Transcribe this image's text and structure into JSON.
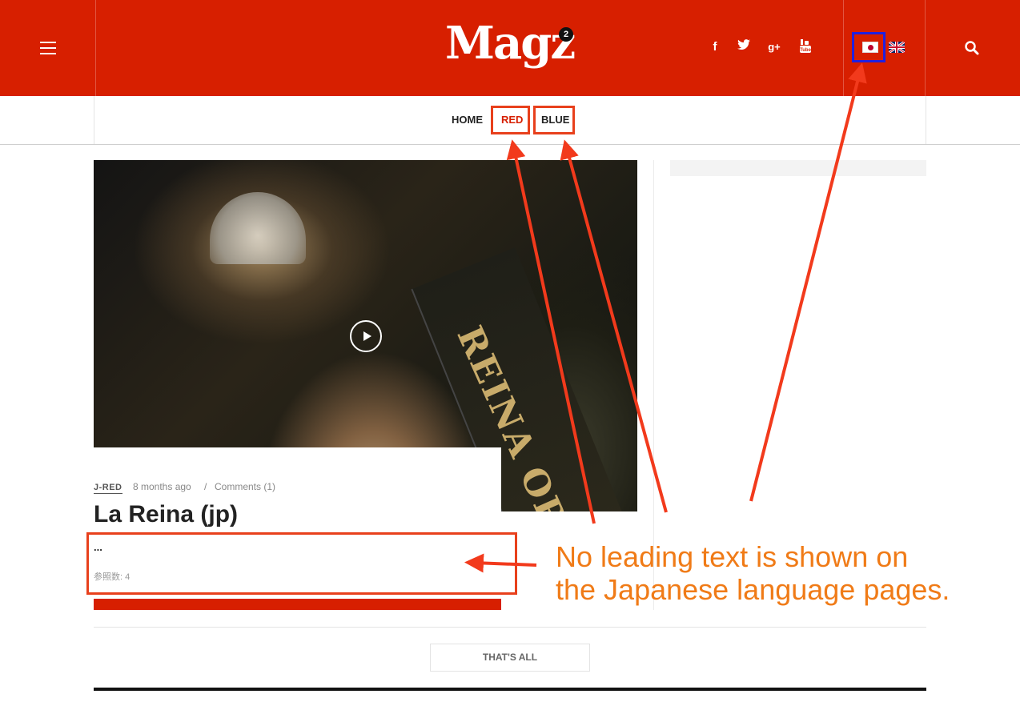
{
  "header": {
    "logo": "Magz",
    "logo_badge": "2",
    "social": [
      "f",
      "t",
      "g+",
      "You Tube"
    ],
    "flags": [
      "jp",
      "gb"
    ],
    "bg_color": "#d71f00"
  },
  "nav": {
    "items": [
      "HOME",
      "RED",
      "BLUE"
    ],
    "active": "RED"
  },
  "article": {
    "category": "J-RED",
    "time": "8 months ago",
    "separator": "/",
    "comments": "Comments (1)",
    "title": "La Reina (jp)",
    "excerpt": "...",
    "views": "参照数: 4"
  },
  "hero_image": {
    "sash_text": "REINA ORF"
  },
  "footer": {
    "more_label": "THAT'S ALL"
  },
  "annotation": {
    "line1": "No leading text is shown on",
    "line2": "the Japanese language pages.",
    "color": "#f07b17",
    "box_color_red": "#e8401c",
    "box_color_blue": "#2020e0"
  }
}
